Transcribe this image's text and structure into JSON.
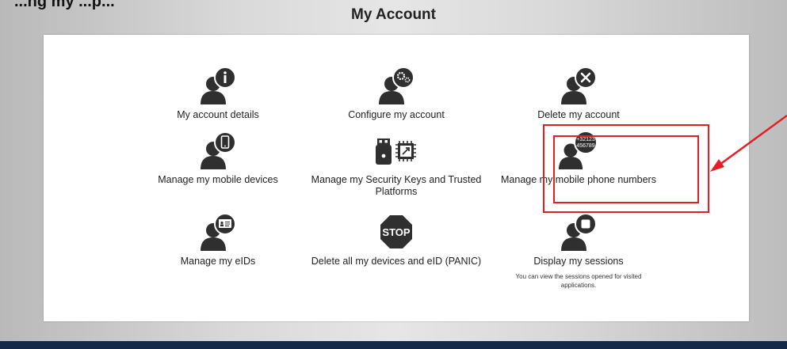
{
  "header": {
    "top_partial_text": "...ng my ...p...",
    "title": "My Account"
  },
  "tiles": [
    {
      "label": "My account details",
      "icon": "user-info-icon"
    },
    {
      "label": "Configure my account",
      "icon": "user-settings-icon"
    },
    {
      "label": "Delete my account",
      "icon": "user-delete-icon"
    },
    {
      "label": "Manage my mobile devices",
      "icon": "user-mobile-icon"
    },
    {
      "label": "Manage my Security Keys and Trusted Platforms",
      "icon": "security-keys-icon"
    },
    {
      "label": "Manage my mobile phone numbers",
      "icon": "user-phone-numbers-icon",
      "badge_line1": "+32123",
      "badge_line2": "456789"
    },
    {
      "label": "Manage my eIDs",
      "icon": "user-eid-icon"
    },
    {
      "label": "Delete all my devices and eID (PANIC)",
      "icon": "stop-sign-icon",
      "sign_text": "STOP"
    },
    {
      "label": "Display my sessions",
      "icon": "user-sessions-icon",
      "sub": "You can view the sessions opened for visited applications."
    }
  ],
  "colors": {
    "icon": "#2f2f2f",
    "annotation": "#e31e24",
    "footer": "#14284a"
  }
}
